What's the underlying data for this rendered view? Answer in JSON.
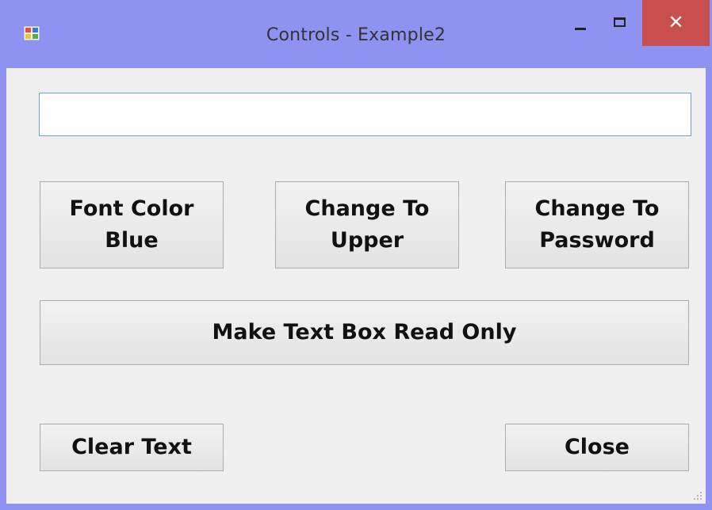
{
  "window": {
    "title": "Controls - Example2",
    "app_icon": "winforms-app-icon",
    "controls": {
      "minimize_icon": "minimize-icon",
      "maximize_icon": "maximize-icon",
      "close_glyph": "✕"
    },
    "colors": {
      "frame": "#8f92f0",
      "client": "#f0f0f0",
      "close_button": "#c94f4f",
      "textbox_border": "#6f9fd8"
    }
  },
  "textbox": {
    "value": ""
  },
  "buttons": {
    "font_color_line1": "Font Color",
    "font_color_line2": "Blue",
    "change_upper_line1": "Change To",
    "change_upper_line2": "Upper",
    "change_password_line1": "Change To",
    "change_password_line2": "Password",
    "read_only": "Make Text Box Read Only",
    "clear_text": "Clear Text",
    "close": "Close"
  }
}
